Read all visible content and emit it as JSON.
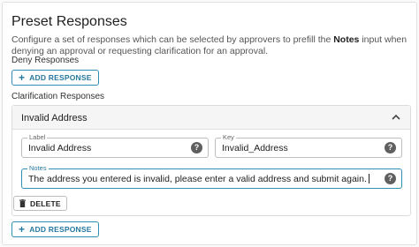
{
  "header": {
    "title": "Preset Responses",
    "description_pre": "Configure a set of responses which can be selected by approvers to prefill the ",
    "description_bold": "Notes",
    "description_post": " input when denying an approval or requesting clarification for an approval."
  },
  "deny": {
    "label": "Deny Responses",
    "add_button": "ADD RESPONSE"
  },
  "clarification": {
    "label": "Clarification Responses",
    "item": {
      "title": "Invalid Address",
      "label_field": {
        "label": "Label",
        "value": "Invalid Address"
      },
      "key_field": {
        "label": "Key",
        "value": "Invalid_Address"
      },
      "notes_field": {
        "label": "Notes",
        "value": "The address you entered is invalid, please enter a valid address and submit again."
      },
      "delete_button": "DELETE"
    },
    "add_button": "ADD RESPONSE"
  },
  "icons": {
    "add": "plus-icon",
    "help": "help-circle-icon",
    "collapse": "chevron-up-icon",
    "delete": "trash-icon"
  },
  "colors": {
    "accent": "#2f8fb3",
    "help_icon": "#5f5f5f"
  }
}
